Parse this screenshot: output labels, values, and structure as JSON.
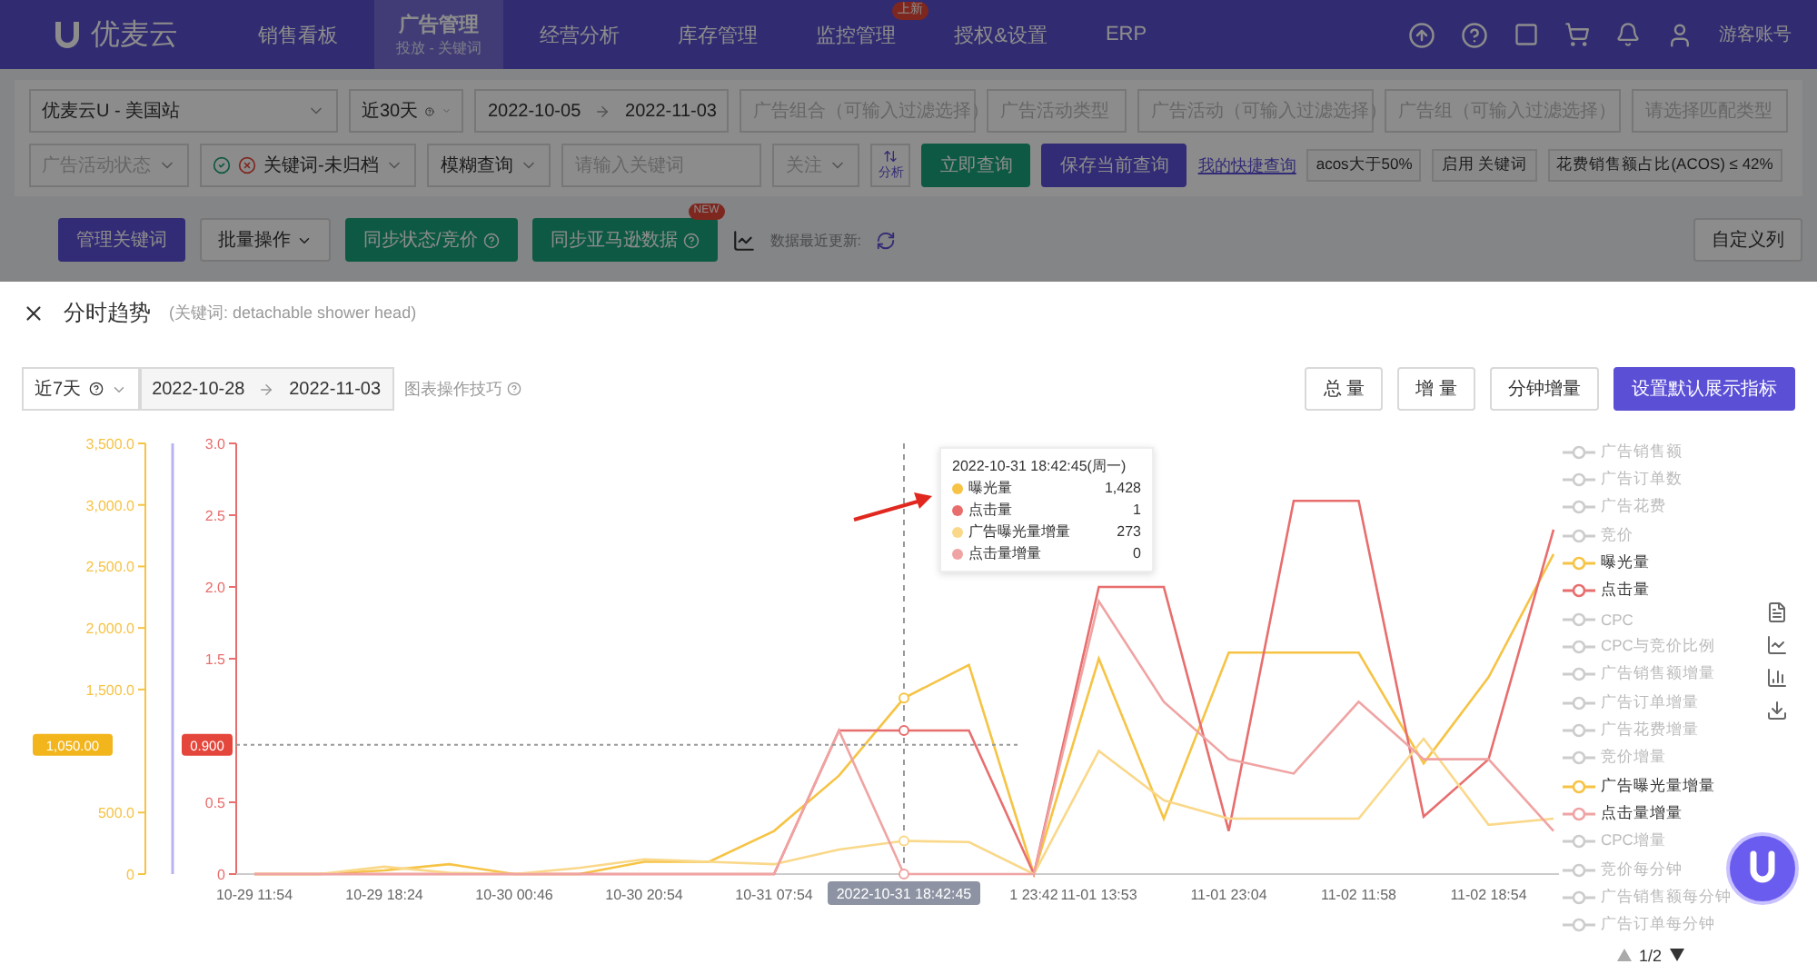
{
  "nav": {
    "logo": "优麦云",
    "items": [
      {
        "label": "销售看板",
        "selected": false
      },
      {
        "label": "广告管理",
        "sub": "投放 - 关键词",
        "selected": true
      },
      {
        "label": "经营分析",
        "selected": false
      },
      {
        "label": "库存管理",
        "selected": false
      },
      {
        "label": "监控管理",
        "badge": "上新",
        "selected": false
      },
      {
        "label": "授权&设置",
        "selected": false
      },
      {
        "label": "ERP",
        "selected": false
      }
    ],
    "user": "游客账号"
  },
  "filters": {
    "row_1": [
      {
        "kind": "select",
        "value": "优麦云U - 美国站"
      },
      {
        "kind": "select",
        "value": "近30天",
        "help": true
      },
      {
        "kind": "date-range",
        "start": "2022-10-05",
        "end": "2022-11-03"
      },
      {
        "kind": "input",
        "placeholder": "广告组合（可输入过滤选择）"
      },
      {
        "kind": "select",
        "placeholder": "广告活动类型"
      },
      {
        "kind": "input",
        "placeholder": "广告活动（可输入过滤选择）"
      },
      {
        "kind": "input",
        "placeholder": "广告组（可输入过滤选择）"
      },
      {
        "kind": "select",
        "placeholder": "请选择匹配类型"
      }
    ],
    "row_2": [
      {
        "kind": "select",
        "placeholder": "广告活动状态"
      },
      {
        "kind": "status-select",
        "value": "关键词-未归档"
      },
      {
        "kind": "select",
        "value": "模糊查询"
      },
      {
        "kind": "input",
        "placeholder": "请输入关键词"
      },
      {
        "kind": "select",
        "placeholder": "关注"
      },
      {
        "kind": "icon-button",
        "label": "分析"
      },
      {
        "kind": "green-button",
        "label": "立即查询"
      },
      {
        "kind": "primary-button",
        "label": "保存当前查询"
      },
      {
        "kind": "link",
        "label": "我的快捷查询"
      },
      {
        "kind": "tag",
        "label": "acos大于50%"
      },
      {
        "kind": "tag",
        "label": "启用 关键词"
      },
      {
        "kind": "tag",
        "label": "花费销售额占比(ACOS) ≤ 42%"
      }
    ]
  },
  "actions": {
    "left": [
      {
        "kind": "primary-button",
        "label": "管理关键词"
      },
      {
        "kind": "dropdown",
        "label": "批量操作"
      },
      {
        "kind": "green-button",
        "label": "同步状态/竞价",
        "help": true
      },
      {
        "kind": "green-button",
        "label": "同步亚马逊数据",
        "help": true,
        "badge": "NEW"
      }
    ],
    "updated": "数据最近更新:",
    "right": "自定义列"
  },
  "modal": {
    "title": "分时趋势",
    "subtitle": "(关键词:  detachable shower head)",
    "toolbar": {
      "range": "近7天",
      "start": "2022-10-28",
      "end": "2022-11-03",
      "hint": "图表操作技巧",
      "buttons": [
        {
          "label": "总 量",
          "kind": "outline-button"
        },
        {
          "label": "增 量",
          "kind": "outline-button"
        },
        {
          "label": "分钟增量",
          "kind": "outline-button"
        },
        {
          "label": "设置默认展示指标",
          "kind": "primary-button"
        }
      ]
    },
    "chart": {
      "chart_data": {
        "type": "line",
        "categories": [
          "10-29 11:54",
          null,
          "10-29 18:24",
          null,
          "10-30 00:46",
          null,
          "10-30 20:54",
          null,
          "10-31 07:54",
          null,
          null,
          null,
          "1 23:42",
          "11-01 13:53",
          null,
          "11-01 23:04",
          null,
          "11-02 11:58",
          null,
          "11-02 18:54",
          null
        ],
        "ylim": [
          0,
          3500
        ],
        "yticks": [
          {
            "value": 0,
            "label": "0"
          },
          {
            "value": 500,
            "label": "500.0"
          },
          {
            "value": 1500,
            "label": "1,500.0"
          },
          {
            "value": 2000,
            "label": "2,000.0"
          },
          {
            "value": 2500,
            "label": "2,500.0"
          },
          {
            "value": 3000,
            "label": "3,000.0"
          },
          {
            "value": 3500,
            "label": "3,500.0"
          }
        ],
        "y2lim": [
          0,
          3
        ],
        "y2ticks": [
          {
            "value": 0,
            "label": "0"
          },
          {
            "value": 0.5,
            "label": "0.5"
          },
          {
            "value": 1.5,
            "label": "1.5"
          },
          {
            "value": 2,
            "label": "2.0"
          },
          {
            "value": 2.5,
            "label": "2.5"
          },
          {
            "value": 3,
            "label": "3.0"
          }
        ],
        "series": [
          {
            "name": "曝光量",
            "color": "#f6c344",
            "values": [
              0,
              0,
              30,
              80,
              0,
              0,
              100,
              100,
              350,
              800,
              1430,
              1700,
              0,
              1750,
              450,
              1800,
              1800,
              1800,
              900,
              1600,
              2600
            ]
          },
          {
            "name": "点击量",
            "color": "#e86e6e",
            "axis": "y2",
            "values": [
              0,
              0,
              0,
              0,
              0,
              0,
              0,
              0,
              0,
              1,
              1,
              1,
              0,
              2,
              2,
              0.3,
              2.6,
              2.6,
              0.4,
              0.8,
              2.4
            ]
          },
          {
            "name": "广告曝光量增量",
            "color": "#fad88a",
            "values": [
              0,
              0,
              60,
              10,
              0,
              50,
              120,
              100,
              80,
              200,
              270,
              260,
              0,
              1000,
              600,
              450,
              450,
              450,
              1100,
              400,
              450
            ]
          },
          {
            "name": "点击量增量",
            "color": "#f0a3a3",
            "axis": "y2",
            "values": [
              0,
              0,
              0,
              0,
              0,
              0,
              0,
              0,
              0,
              1,
              0,
              0,
              0,
              1.9,
              1.2,
              0.8,
              0.7,
              1.2,
              0.8,
              0.8,
              0.3
            ]
          }
        ],
        "annotations": [
          "2022-10-31 18:42:45",
          "1,050.00",
          "0.900"
        ]
      },
      "tooltip": {
        "title": "2022-10-31 18:42:45(周一)",
        "rows": [
          {
            "value": "1,428"
          },
          {
            "value": "1"
          },
          {
            "value": "273"
          },
          {
            "value": "0"
          }
        ]
      },
      "legend": {
        "items": [
          {
            "name": "广告销售额",
            "selected": false
          },
          {
            "name": "广告订单数",
            "selected": false
          },
          {
            "name": "广告花费",
            "selected": false
          },
          {
            "name": "竞价",
            "selected": false
          },
          {
            "name": "曝光量",
            "selected": true,
            "color": "#f6c344"
          },
          {
            "name": "点击量",
            "selected": true,
            "color": "#e86e6e"
          },
          {
            "name": "CPC",
            "selected": false
          },
          {
            "name": "CPC与竞价比例",
            "selected": false
          },
          {
            "name": "广告销售额增量",
            "selected": false
          },
          {
            "name": "广告订单增量",
            "selected": false
          },
          {
            "name": "广告花费增量",
            "selected": false
          },
          {
            "name": "竞价增量",
            "selected": false
          },
          {
            "name": "广告曝光量增量",
            "selected": true,
            "color": "#f6c344"
          },
          {
            "name": "点击量增量",
            "selected": true,
            "color": "#f0a3a3"
          },
          {
            "name": "CPC增量",
            "selected": false
          },
          {
            "name": "竞价每分钟",
            "selected": false
          },
          {
            "name": "广告销售额每分钟",
            "selected": false
          },
          {
            "name": "广告订单每分钟",
            "selected": false
          }
        ],
        "pager": "1/2"
      }
    }
  }
}
